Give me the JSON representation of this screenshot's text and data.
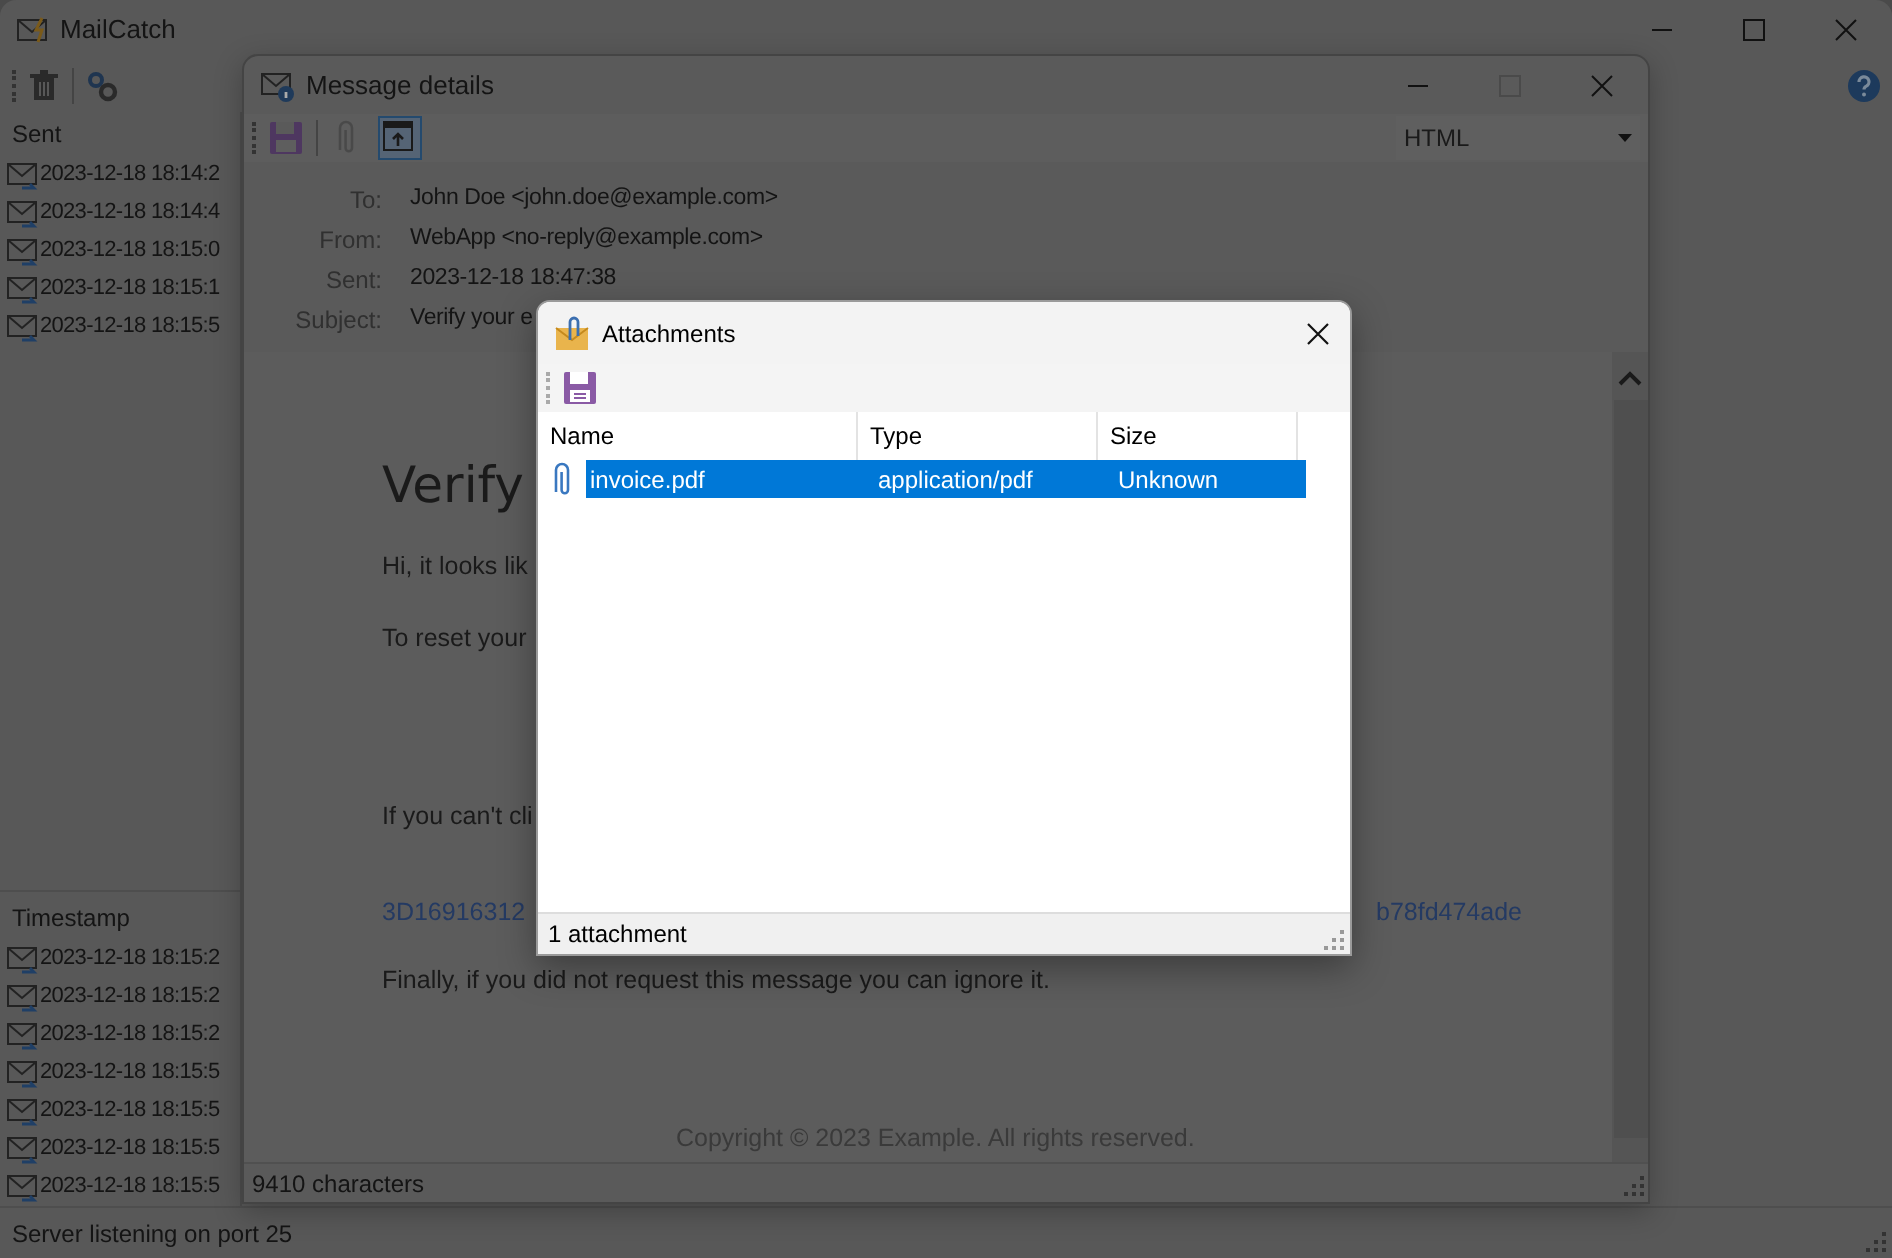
{
  "main_window": {
    "title": "MailCatch"
  },
  "sent_list": {
    "header": "Sent",
    "rows": [
      {
        "timestamp": "2023-12-18 18:14:2"
      },
      {
        "timestamp": "2023-12-18 18:14:4"
      },
      {
        "timestamp": "2023-12-18 18:15:0"
      },
      {
        "timestamp": "2023-12-18 18:15:1"
      },
      {
        "timestamp": "2023-12-18 18:15:5"
      }
    ]
  },
  "received_list": {
    "header": "Timestamp",
    "rows": [
      {
        "timestamp": "2023-12-18 18:15:2"
      },
      {
        "timestamp": "2023-12-18 18:15:2"
      },
      {
        "timestamp": "2023-12-18 18:15:2"
      },
      {
        "timestamp": "2023-12-18 18:15:5"
      },
      {
        "timestamp": "2023-12-18 18:15:5"
      },
      {
        "timestamp": "2023-12-18 18:15:5"
      },
      {
        "timestamp": "2023-12-18 18:15:5"
      }
    ]
  },
  "status_bar": "Server listening on port 25",
  "message_window": {
    "title": "Message details",
    "toolbar": [
      {
        "kind": "save",
        "disabled": false,
        "pressed": false
      },
      {
        "kind": "attachments",
        "disabled": true,
        "pressed": false
      },
      {
        "kind": "view",
        "disabled": false,
        "pressed": true
      }
    ],
    "format": "HTML",
    "headers": [
      {
        "label": "To:",
        "value": "John Doe <john.doe@example.com>"
      },
      {
        "label": "From:",
        "value": "WebApp <no-reply@example.com>"
      },
      {
        "label": "Sent:",
        "value": "2023-12-18 18:47:38"
      },
      {
        "label": "Subject:",
        "value": "Verify your e"
      }
    ],
    "body": {
      "heading": "Verify",
      "paragraphs": [
        "Hi, it looks lik",
        "To reset your",
        "If you can't cli"
      ],
      "link_left": "3D16916312",
      "link_right": "b78fd474ade",
      "closing": "Finally, if you did not request this message you can ignore it.",
      "footer": "Copyright © 2023 Example. All rights reserved."
    },
    "status": "9410 characters"
  },
  "attachments_dialog": {
    "title": "Attachments",
    "columns": [
      "Name",
      "Type",
      "Size"
    ],
    "rows": [
      {
        "name": "invoice.pdf",
        "type": "application/pdf",
        "size": "Unknown",
        "selected": true
      }
    ],
    "status": "1 attachment"
  }
}
